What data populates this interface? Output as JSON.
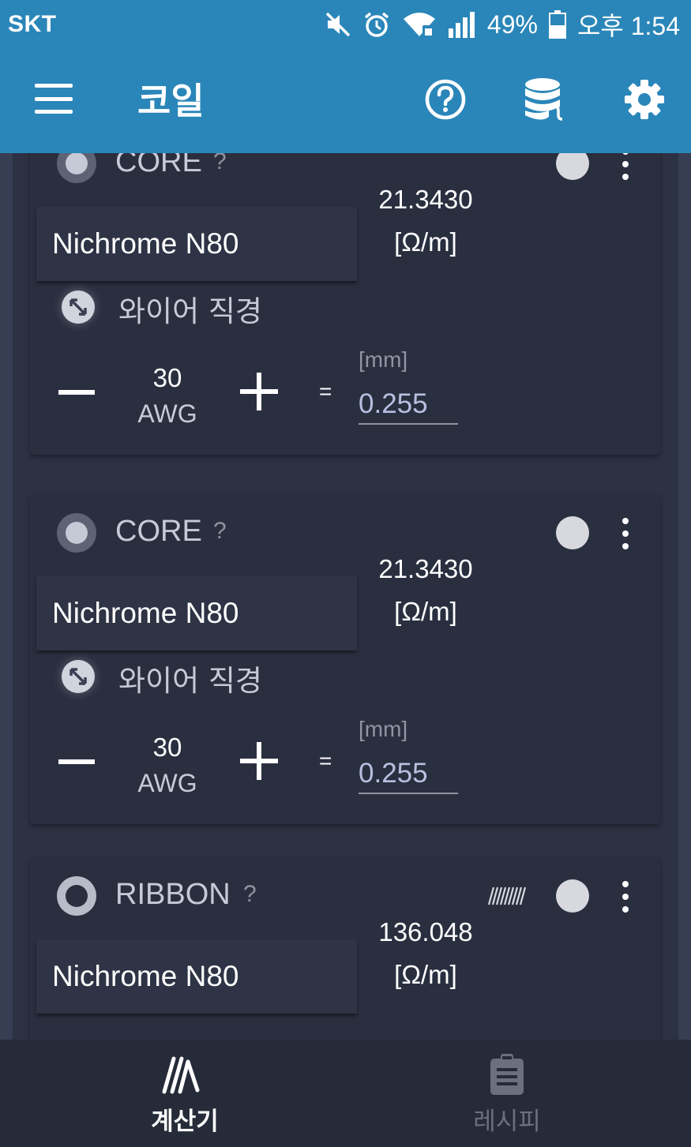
{
  "status_bar": {
    "carrier": "SKT",
    "battery": "49%",
    "time": "오후 1:54"
  },
  "app_bar": {
    "title": "코일",
    "icons": [
      "menu-icon",
      "help-icon",
      "database-icon",
      "settings-icon"
    ]
  },
  "cards": [
    {
      "type": "CORE",
      "help": "?",
      "material": "Nichrome N80",
      "resistance": "21.3430",
      "resistance_unit": "[Ω/m]",
      "wire_label": "와이어 직경",
      "gauge": "30",
      "gauge_unit": "AWG",
      "equals": "=",
      "diameter_unit": "[mm]",
      "diameter": "0.255"
    },
    {
      "type": "CORE",
      "help": "?",
      "material": "Nichrome N80",
      "resistance": "21.3430",
      "resistance_unit": "[Ω/m]",
      "wire_label": "와이어 직경",
      "gauge": "30",
      "gauge_unit": "AWG",
      "equals": "=",
      "diameter_unit": "[mm]",
      "diameter": "0.255"
    },
    {
      "type": "RIBBON",
      "help": "?",
      "material": "Nichrome N80",
      "resistance": "136.048",
      "resistance_unit": "[Ω/m]"
    }
  ],
  "bottom_nav": {
    "items": [
      {
        "label": "계산기",
        "icon": "calculator-icon",
        "active": true
      },
      {
        "label": "레시피",
        "icon": "clipboard-icon",
        "active": false
      }
    ]
  },
  "colors": {
    "primary": "#2a86b9",
    "card_bg": "#2a2f40",
    "page_bg": "#373d52",
    "nav_bg": "#262b39",
    "muted_text": "#c6cbd8"
  }
}
